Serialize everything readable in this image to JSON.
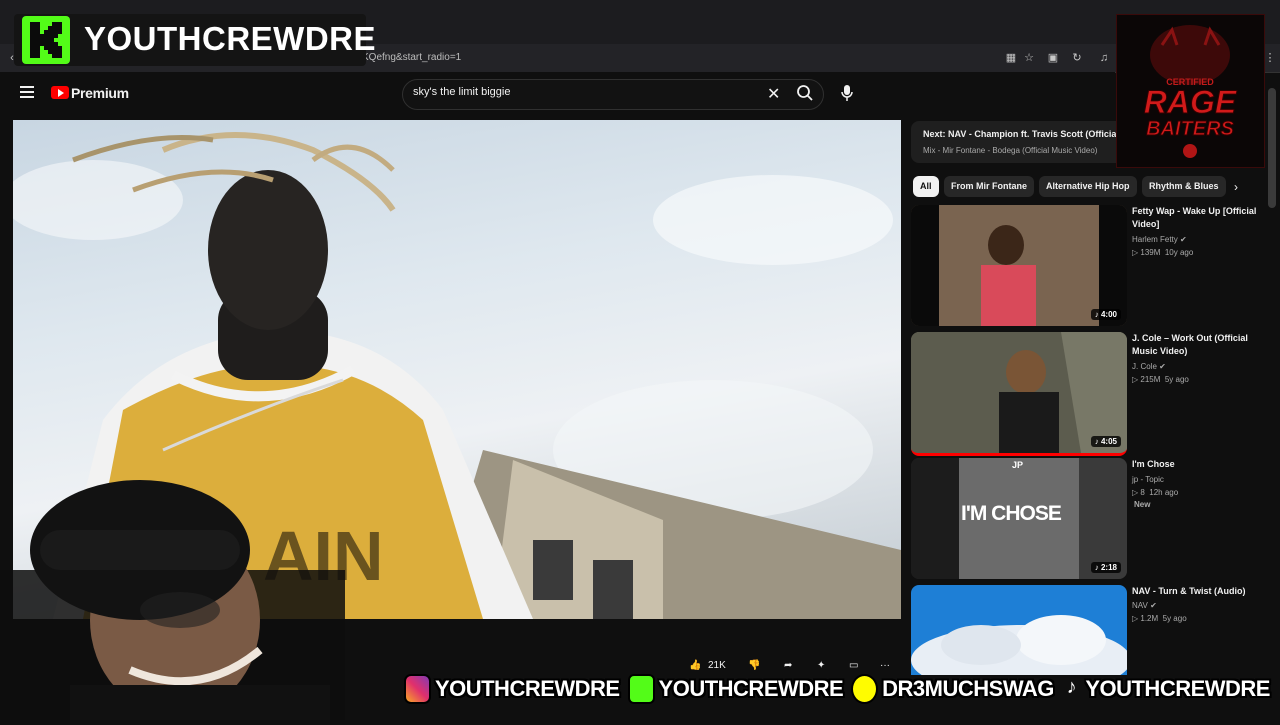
{
  "overlay": {
    "kick_name": "YOUTHCREWDRE",
    "rage_logo": "CERTIFIED RAGE BAITERS",
    "banner": [
      {
        "icon": "instagram-icon",
        "text": "YOUTHCREWDRE"
      },
      {
        "icon": "kick-icon",
        "text": "YOUTHCREWDRE"
      },
      {
        "icon": "snapchat-icon",
        "text": "DR3MUCHSWAG"
      },
      {
        "icon": "tiktok-icon",
        "text": "YOUTHCREWDRE"
      }
    ]
  },
  "browser": {
    "url_fragment": "KQefng&start_radio=1"
  },
  "header": {
    "brand": "Premium",
    "search_value": "sky's the limit biggie"
  },
  "next_card": {
    "label": "Next:",
    "title": "NAV - Champion ft. Travis Scott (Official",
    "subtitle": "Mix - Mir Fontane - Bodega (Official Music Video)"
  },
  "chips": [
    "All",
    "From Mir Fontane",
    "Alternative Hip Hop",
    "Rhythm & Blues"
  ],
  "recommendations": [
    {
      "title": "Fetty Wap - Wake Up [Official Video]",
      "channel": "Harlem Fetty",
      "views": "139M",
      "age": "10y ago",
      "duration": "4:00"
    },
    {
      "title": "J. Cole – Work Out (Official Music Video)",
      "channel": "J. Cole",
      "views": "215M",
      "age": "5y ago",
      "duration": "4:05"
    },
    {
      "title": "I'm Chose",
      "channel": "jp - Topic",
      "views": "8",
      "age": "12h ago",
      "duration": "2:18",
      "badge": "New",
      "thumb_text": "I'M CHOSE",
      "thumb_logo": "JP"
    },
    {
      "title": "NAV - Turn & Twist (Audio)",
      "channel": "NAV",
      "views": "1.2M",
      "age": "5y ago"
    }
  ],
  "actions": {
    "likes": "21K"
  },
  "colors": {
    "kick_green": "#53fc18",
    "yt_red": "#ff0000",
    "bg": "#0f0f0f"
  }
}
